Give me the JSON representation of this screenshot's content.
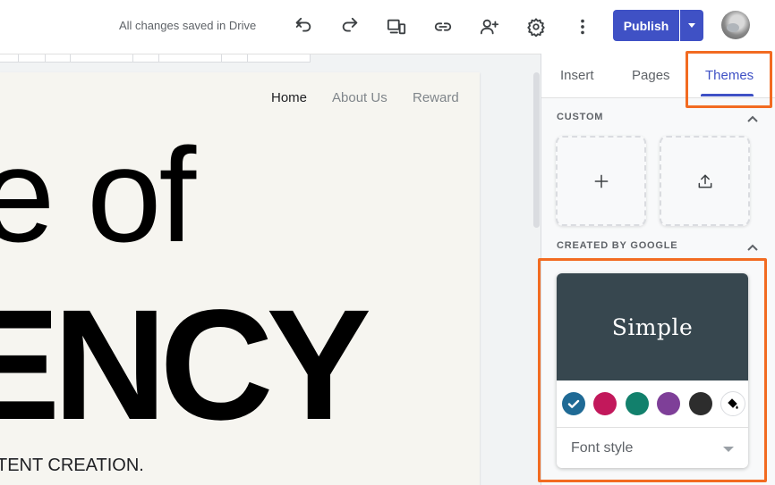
{
  "toolbar": {
    "status_text": "All changes saved in Drive",
    "publish_label": "Publish",
    "icons": [
      "undo-icon",
      "redo-icon",
      "preview-devices-icon",
      "link-icon",
      "share-icon",
      "settings-icon",
      "more-vert-icon"
    ]
  },
  "site": {
    "nav": {
      "home": "Home",
      "about": "About Us",
      "reward": "Reward"
    },
    "hero_line1": "e of",
    "hero_line2": "ENCY",
    "hero_sub": "TENT CREATION."
  },
  "panel": {
    "tabs": {
      "insert": "Insert",
      "pages": "Pages",
      "themes": "Themes"
    },
    "active_tab": "Themes",
    "custom_label": "CUSTOM",
    "google_label": "CREATED BY GOOGLE",
    "theme": {
      "name": "Simple",
      "preview_color": "#37474f",
      "swatches": [
        "#1f6a95",
        "#c2185b",
        "#12806c",
        "#7e3f98",
        "#2d2d2d"
      ],
      "selected_swatch": 0,
      "font_style_label": "Font style"
    }
  },
  "colors": {
    "accent": "#3f51c5",
    "highlight": "#f26b21"
  }
}
